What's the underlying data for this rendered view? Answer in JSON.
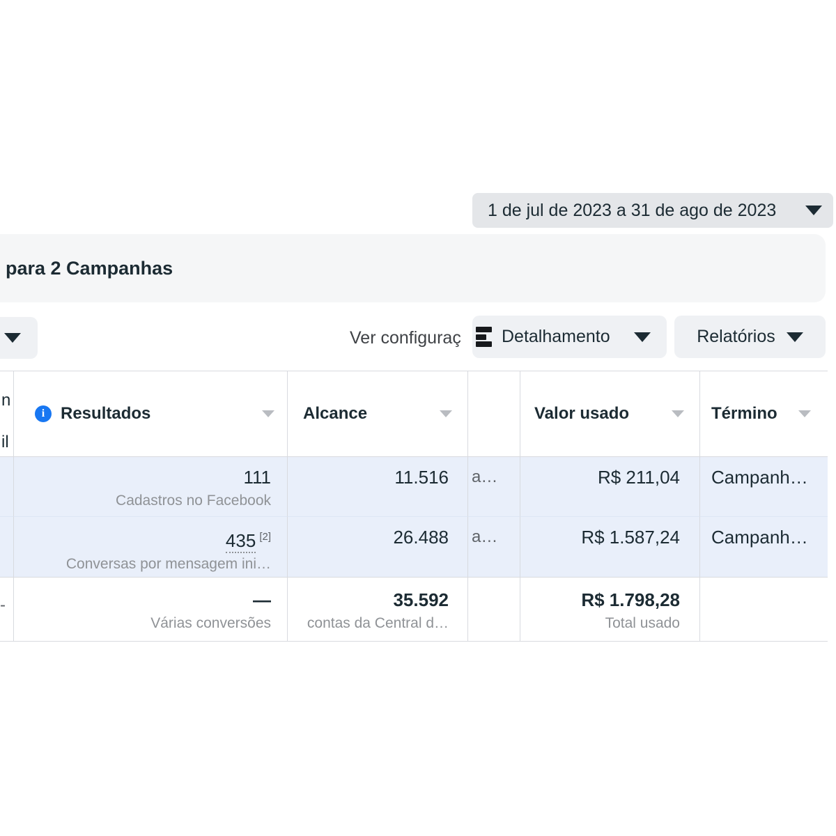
{
  "date_range": {
    "label": "1 de jul de 2023 a 31 de ago de 2023"
  },
  "header": {
    "title": "para 2 Campanhas"
  },
  "toolbar": {
    "view_settings_label": "Ver configuraç",
    "breakdown_label": "Detalhamento",
    "reports_label": "Relatórios"
  },
  "icons": {
    "info_glyph": "i"
  },
  "table": {
    "clipped_left_header": [
      "n",
      "il"
    ],
    "columns": [
      {
        "label": "Resultados"
      },
      {
        "label": "Alcance"
      },
      {
        "label": ""
      },
      {
        "label": "Valor usado"
      },
      {
        "label": "Término"
      }
    ],
    "rows": [
      {
        "resultados": "111",
        "resultados_sub": "Cadastros no Facebook",
        "alcance": "11.516",
        "attr": "a…",
        "valor": "R$ 211,04",
        "termino": "Campanh…"
      },
      {
        "resultados": "435",
        "resultados_sup": "[2]",
        "resultados_sub": "Conversas por mensagem ini…",
        "alcance": "26.488",
        "attr": "a…",
        "valor": "R$ 1.587,24",
        "termino": "Campanh…"
      }
    ],
    "summary": {
      "clipped_left": "-",
      "resultados": "—",
      "resultados_sub": "Várias conversões",
      "alcance": "35.592",
      "alcance_sub": "contas da Central d…",
      "valor": "R$ 1.798,28",
      "valor_sub": "Total usado",
      "termino": ""
    }
  },
  "colors": {
    "accent_blue": "#1877f2",
    "row_highlight": "#e9effa",
    "button_gray": "#eff1f4",
    "date_button_gray": "#e4e6e9",
    "band_gray": "#f5f6f7",
    "border": "#d8dadf",
    "text_dark": "#1c2b33",
    "text_gray": "#8f9296"
  }
}
